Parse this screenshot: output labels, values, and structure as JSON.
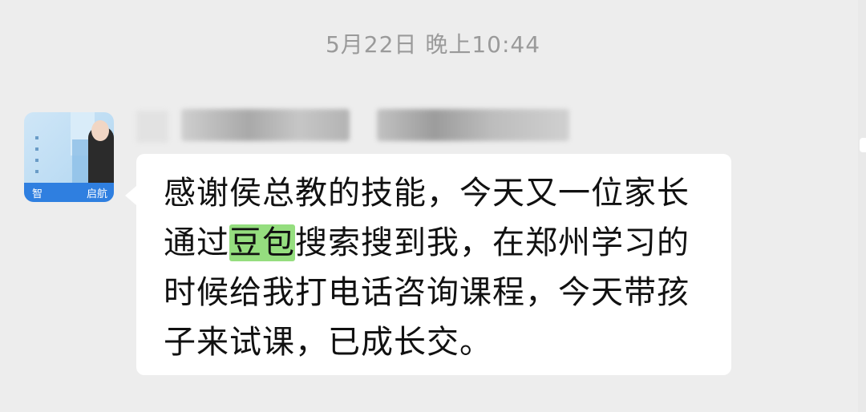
{
  "timestamp": "5月22日 晚上10:44",
  "sender": {
    "avatar_icon": "contact-avatar-image",
    "avatar_bar_text_left": "智",
    "avatar_bar_text_right": "启航"
  },
  "message": {
    "part1": "感谢侯总教的技能，今天又一位家长通过",
    "highlight": "豆包",
    "part2": "搜索搜到我，在郑州学习的时候给我打电话咨询课程，今天带孩子来试课，已成长交。"
  },
  "colors": {
    "background": "#ededed",
    "bubble": "#ffffff",
    "highlight": "#95de7f",
    "timestamp": "#9a9a9a"
  }
}
